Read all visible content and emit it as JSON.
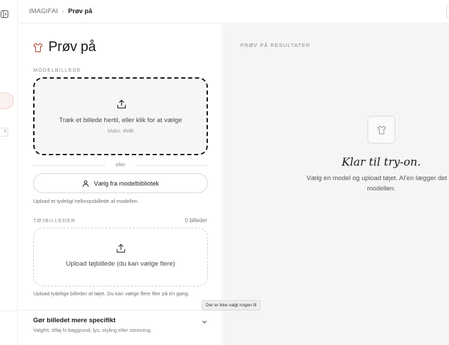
{
  "sidebar": {
    "chip_text": "T"
  },
  "header": {
    "breadcrumb_root": "IMAGIFAI",
    "breadcrumb_separator": "›",
    "breadcrumb_current": "Prøv på"
  },
  "form": {
    "title": "Prøv på",
    "title_icon": "shirt-icon",
    "model_section_label": "MODELBILLEDE",
    "model_dropzone": {
      "icon": "upload-icon",
      "text": "Træk et billede hertil, eller klik for at vælge",
      "subtext": "Maks. 4MB"
    },
    "or_text": "eller",
    "library_button": {
      "icon": "user-icon",
      "label": "Vælg fra modelbibliotek"
    },
    "model_hint": "Upload et tydeligt helkropsbillede af modellen.",
    "clothes_section_label": "TØJBILLEDER",
    "clothes_count": "0 billeder",
    "clothes_dropzone": {
      "icon": "upload-icon",
      "text": "Upload tøjbillede (du kan vælge flere)"
    },
    "clothes_hint": "Upload tydelige billeder af tøjet. Du kan vælge flere filer på én gang.",
    "accordion": {
      "title": "Gør billedet mere specifikt",
      "subtitle": "Valgfrit, tilføj fx baggrund, lys, styling eller stemning.",
      "icon": "chevron-down-icon"
    }
  },
  "tooltip": "Der er ikke valgt nogen fil",
  "result": {
    "label": "PRØV PÅ RESULTATER",
    "empty_icon": "shirt-icon",
    "empty_title": "Klar til try-on.",
    "empty_desc_line1": "Vælg en model og upload tøjet. AI'en lægger det på",
    "empty_desc_line2": "modellen."
  },
  "colors": {
    "accent_pill_bg": "#fbf2f0",
    "accent_pill_border": "#ead0c8",
    "result_bg": "#f5f5f5",
    "dropzone_bg": "#f6f6f6"
  }
}
